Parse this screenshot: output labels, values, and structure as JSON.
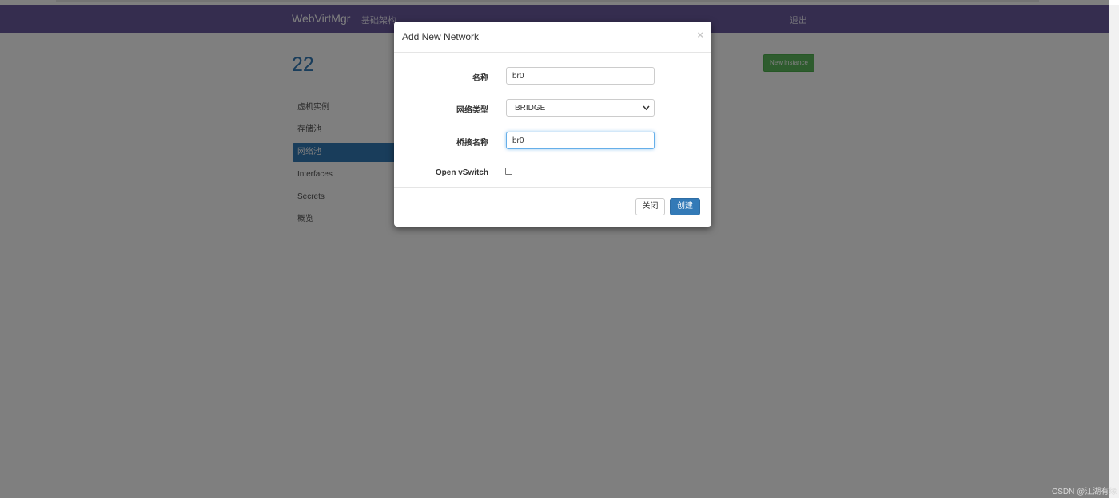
{
  "navbar": {
    "brand": "WebVirtMgr",
    "infrastructure": "基础架构",
    "logout": "退出"
  },
  "host": {
    "title": "22",
    "new_instance_label": "New instance"
  },
  "sidebar": {
    "items": [
      {
        "label": "虚机实例",
        "active": false
      },
      {
        "label": "存储池",
        "active": false
      },
      {
        "label": "网络池",
        "active": true
      },
      {
        "label": "Interfaces",
        "active": false
      },
      {
        "label": "Secrets",
        "active": false
      },
      {
        "label": "概览",
        "active": false
      }
    ]
  },
  "modal": {
    "title": "Add New Network",
    "close_glyph": "×",
    "fields": {
      "name_label": "名称",
      "name_value": "br0",
      "type_label": "网络类型",
      "type_value": "BRIDGE",
      "bridge_label": "桥接名称",
      "bridge_value": "br0",
      "ovs_label": "Open vSwitch",
      "ovs_checked": false
    },
    "buttons": {
      "close_label": "关闭",
      "create_label": "创建"
    }
  },
  "watermark": "CSDN @江湖有缘",
  "colors": {
    "navbar": "#6a5b9e",
    "primary": "#337ab7",
    "success": "#5cb85c",
    "focus": "#66afe9"
  }
}
